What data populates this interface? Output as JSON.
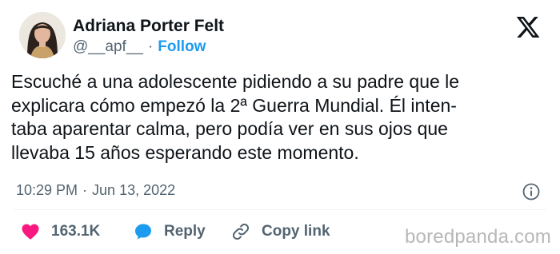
{
  "author": {
    "name": "Adriana Porter Felt",
    "handle": "@__apf__",
    "separator": "·",
    "follow_label": "Follow",
    "avatar_icon": "profile-photo",
    "platform_icon": "x-logo-icon"
  },
  "tweet": {
    "lines": [
      "Escuché a una adolescente pidiendo a su padre que le",
      "explicara cómo empezó la 2ª Guerra Mundial. Él inten-",
      "taba aparentar calma, pero podía ver en sus ojos que",
      "llevaba 15 años esperando este momento."
    ]
  },
  "meta": {
    "time": "10:29 PM",
    "separator": "·",
    "date": "Jun 13, 2022",
    "info_icon": "info-icon"
  },
  "actions": {
    "like_count": "163.1K",
    "reply_label": "Reply",
    "copy_label": "Copy link"
  },
  "watermark": "boredpanda.com",
  "colors": {
    "accent": "#1d9bf0",
    "like": "#f91880",
    "text": "#0f1419",
    "muted": "#536471",
    "watermark": "#b7b7b7"
  }
}
